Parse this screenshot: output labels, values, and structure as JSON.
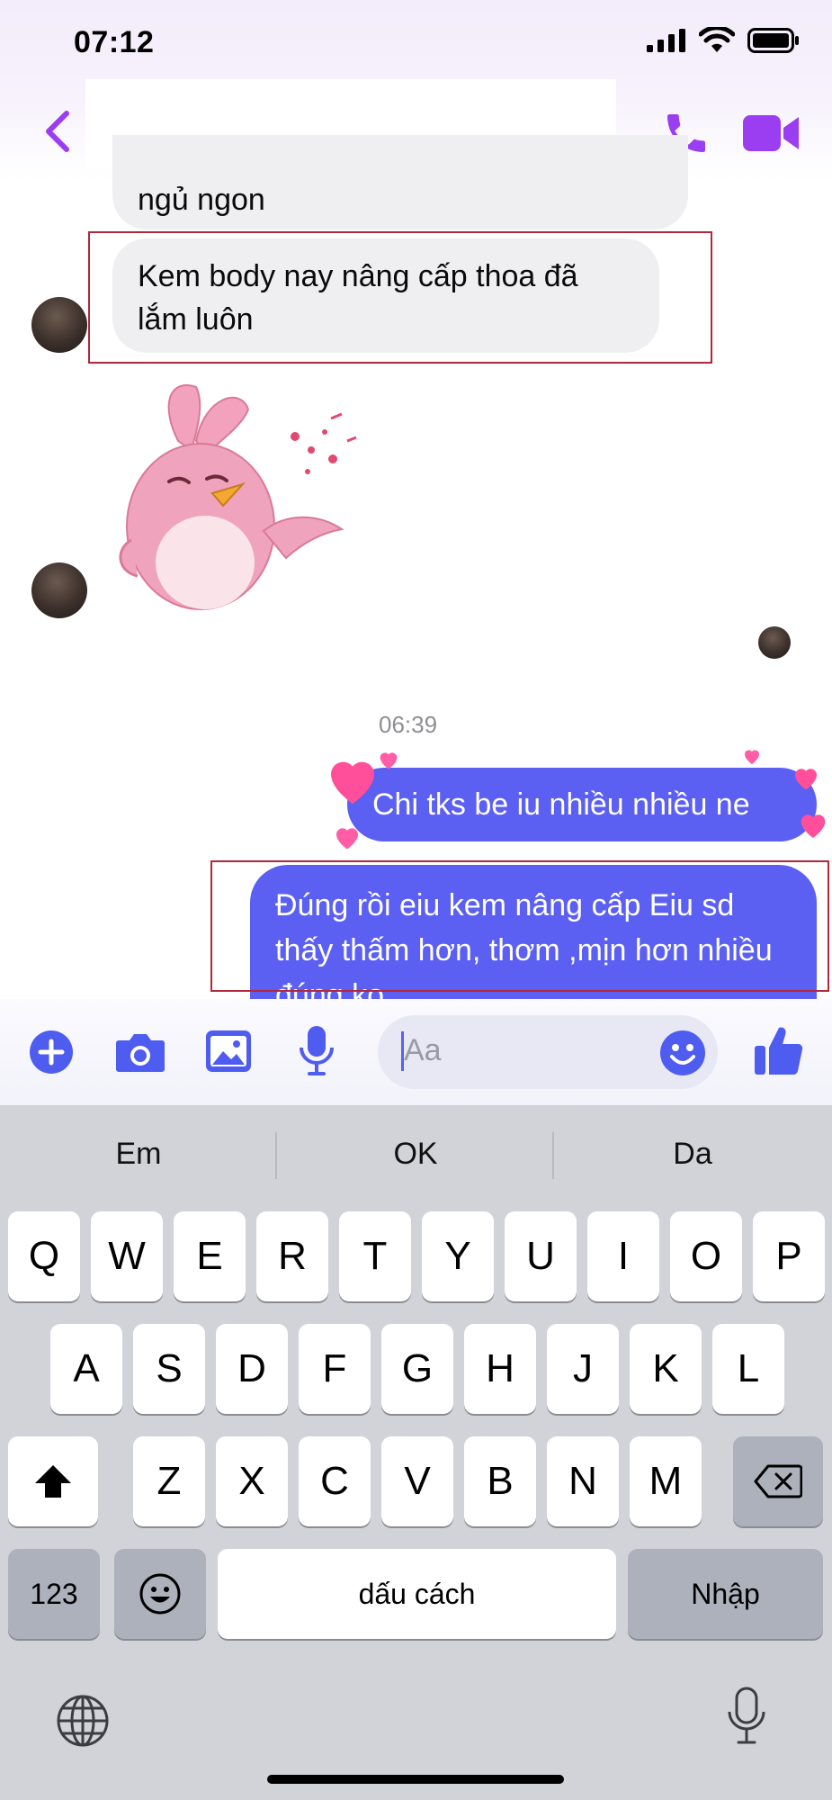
{
  "status_bar": {
    "time": "07:12"
  },
  "messages": {
    "incoming_1": "ngủ ngon",
    "incoming_2": "Kem body nay nâng cấp thoa đã lắm luôn",
    "timestamp": "06:39",
    "outgoing_1": "Chi tks be iu nhiều nhiều ne",
    "outgoing_2": "Đúng rồi eiu kem nâng cấp Eiu sd thấy thấm hơn, thơm ,mịn hơn nhiều đúng ko"
  },
  "composer": {
    "placeholder": "Aa"
  },
  "keyboard": {
    "suggestions": [
      "Em",
      "OK",
      "Da"
    ],
    "row1": [
      "Q",
      "W",
      "E",
      "R",
      "T",
      "Y",
      "U",
      "I",
      "O",
      "P"
    ],
    "row2": [
      "A",
      "S",
      "D",
      "F",
      "G",
      "H",
      "J",
      "K",
      "L"
    ],
    "row3": [
      "Z",
      "X",
      "C",
      "V",
      "B",
      "N",
      "M"
    ],
    "numbers_key": "123",
    "space_key": "dấu cách",
    "return_key": "Nhập"
  },
  "colors": {
    "accent": "#9b3df0",
    "outgoing_bubble": "#5b5ff2",
    "incoming_bubble": "#efeff2",
    "composer_icons": "#4f5cf0",
    "highlight_border": "#b0283a"
  },
  "icons": {
    "header": [
      "chevron-left-icon",
      "phone-icon",
      "video-camera-icon"
    ],
    "composer": [
      "plus-icon",
      "camera-icon",
      "image-icon",
      "microphone-icon",
      "emoji-icon",
      "thumbs-up-icon"
    ],
    "keyboard": [
      "shift-icon",
      "delete-icon",
      "emoji-icon",
      "globe-icon",
      "microphone-icon"
    ]
  }
}
